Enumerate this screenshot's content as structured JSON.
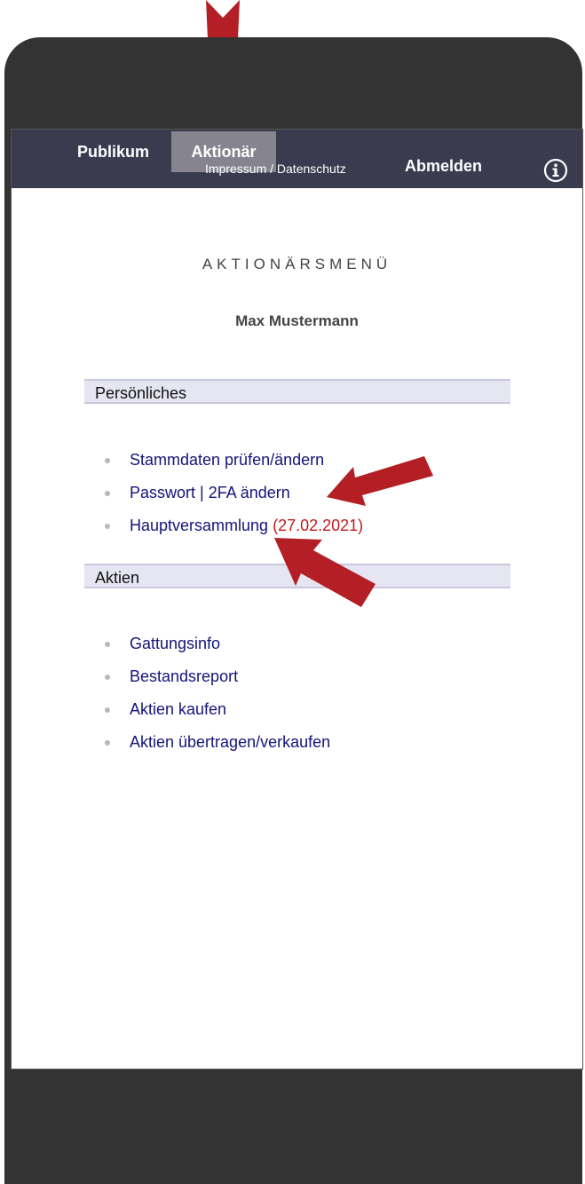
{
  "nav": {
    "tab_public": "Publikum",
    "tab_shareholder": "Aktionär",
    "imprint_link": "Impressum / Datenschutz",
    "logout": "Abmelden",
    "info_icon": "info-circle-icon"
  },
  "page": {
    "menu_title": "AKTIONÄRSMENÜ",
    "user_name": "Max Mustermann"
  },
  "sections": {
    "personal": {
      "title": "Persönliches",
      "items": [
        {
          "label": "Stammdaten prüfen/ändern"
        },
        {
          "label": "Passwort | 2FA ändern"
        },
        {
          "label": "Hauptversammlung",
          "date": "(27.02.2021)"
        }
      ]
    },
    "shares": {
      "title": "Aktien",
      "items": [
        {
          "label": "Gattungsinfo"
        },
        {
          "label": "Bestandsreport"
        },
        {
          "label": "Aktien kaufen"
        },
        {
          "label": "Aktien übertragen/verkaufen"
        }
      ]
    }
  },
  "colors": {
    "navbar": "#3b3b50",
    "active_tab": "#86858f",
    "link": "#14147a",
    "date": "#c11b1b",
    "section_bg": "#e6e6f3",
    "annotation_arrow": "#b31f24",
    "phone_frame": "#333333"
  }
}
